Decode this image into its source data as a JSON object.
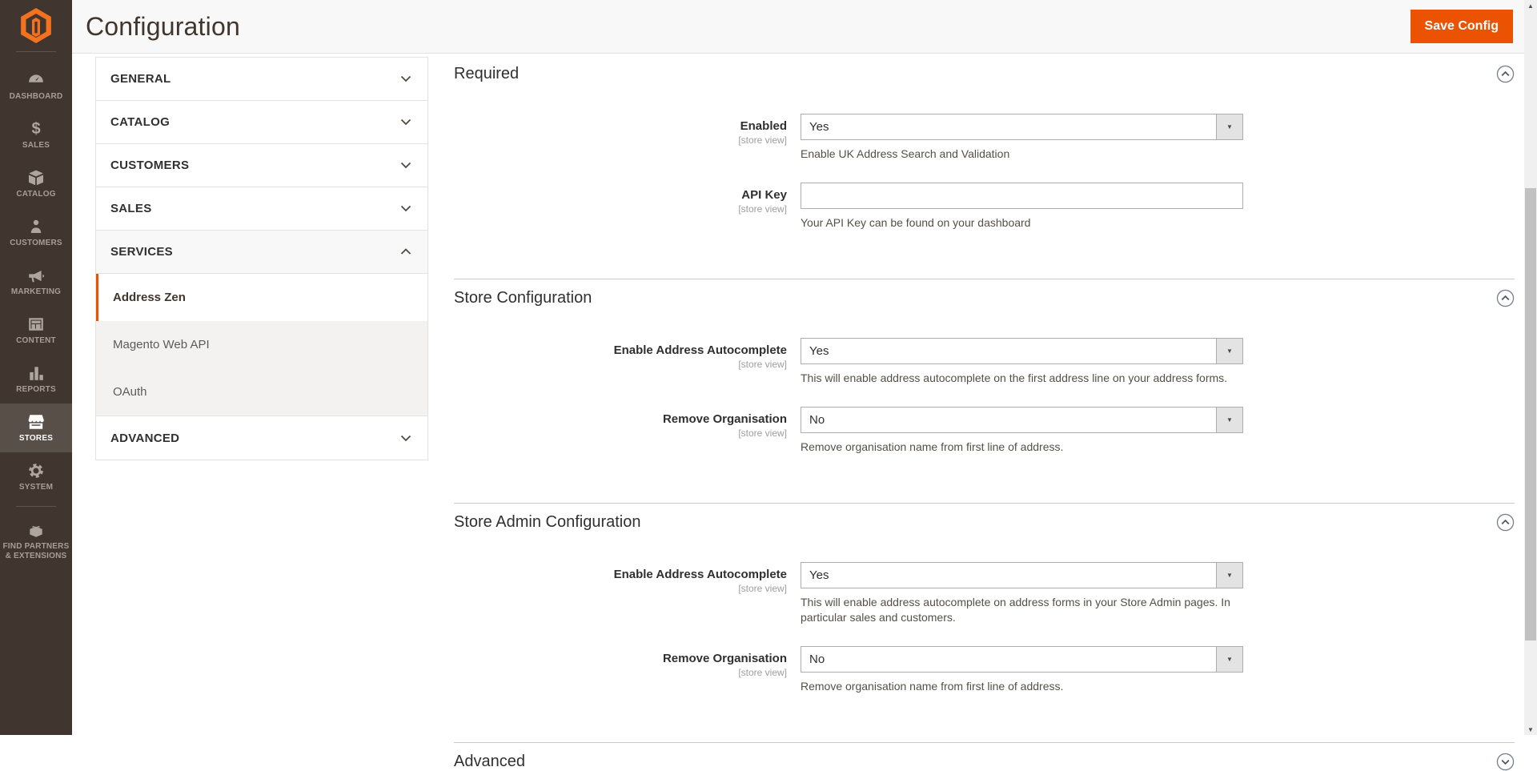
{
  "app": {
    "title": "Configuration",
    "save_button": "Save Config"
  },
  "colors": {
    "accent_orange": "#eb5202",
    "sidebar_bg": "#41362f",
    "sidebar_active_bg": "#584f48",
    "header_bg": "#f8f8f8",
    "border": "#e3e3e3",
    "select_border": "#adadad"
  },
  "icons": {
    "sales_glyph": "$",
    "dropdown_arrow": "▼",
    "scroll_up": "▲",
    "scroll_down": "▼"
  },
  "sidebar": {
    "items": [
      {
        "label": "DASHBOARD",
        "icon": "dashboard-icon",
        "active": false
      },
      {
        "label": "SALES",
        "icon": "sales-icon",
        "active": false
      },
      {
        "label": "CATALOG",
        "icon": "catalog-icon",
        "active": false
      },
      {
        "label": "CUSTOMERS",
        "icon": "customers-icon",
        "active": false
      },
      {
        "label": "MARKETING",
        "icon": "marketing-icon",
        "active": false
      },
      {
        "label": "CONTENT",
        "icon": "content-icon",
        "active": false
      },
      {
        "label": "REPORTS",
        "icon": "reports-icon",
        "active": false
      },
      {
        "label": "STORES",
        "icon": "stores-icon",
        "active": true
      },
      {
        "label": "SYSTEM",
        "icon": "system-icon",
        "active": false
      },
      {
        "label": "FIND PARTNERS & EXTENSIONS",
        "icon": "find-partners-icon",
        "active": false
      }
    ]
  },
  "config_nav": {
    "sections": [
      {
        "label": "GENERAL",
        "state": "collapsed"
      },
      {
        "label": "CATALOG",
        "state": "collapsed"
      },
      {
        "label": "CUSTOMERS",
        "state": "collapsed"
      },
      {
        "label": "SALES",
        "state": "collapsed"
      },
      {
        "label": "SERVICES",
        "state": "expanded",
        "children": [
          {
            "label": "Address Zen",
            "current": true
          },
          {
            "label": "Magento Web API",
            "current": false
          },
          {
            "label": "OAuth",
            "current": false
          }
        ]
      },
      {
        "label": "ADVANCED",
        "state": "collapsed"
      }
    ]
  },
  "sections": [
    {
      "title": "Required",
      "state": "expanded",
      "fields": [
        {
          "label": "Enabled",
          "scope": "[store view]",
          "type": "select",
          "value": "Yes",
          "comment": "Enable UK Address Search and Validation"
        },
        {
          "label": "API Key",
          "scope": "[store view]",
          "type": "text",
          "value": "",
          "comment": "Your API Key can be found on your dashboard"
        }
      ]
    },
    {
      "title": "Store Configuration",
      "state": "expanded",
      "fields": [
        {
          "label": "Enable Address Autocomplete",
          "scope": "[store view]",
          "type": "select",
          "value": "Yes",
          "comment": "This will enable address autocomplete on the first address line on your address forms."
        },
        {
          "label": "Remove Organisation",
          "scope": "[store view]",
          "type": "select",
          "value": "No",
          "comment": "Remove organisation name from first line of address."
        }
      ]
    },
    {
      "title": "Store Admin Configuration",
      "state": "expanded",
      "fields": [
        {
          "label": "Enable Address Autocomplete",
          "scope": "[store view]",
          "type": "select",
          "value": "Yes",
          "comment": "This will enable address autocomplete on address forms in your Store Admin pages. In particular sales and customers."
        },
        {
          "label": "Remove Organisation",
          "scope": "[store view]",
          "type": "select",
          "value": "No",
          "comment": "Remove organisation name from first line of address."
        }
      ]
    },
    {
      "title": "Advanced",
      "state": "collapsed",
      "fields": []
    }
  ]
}
